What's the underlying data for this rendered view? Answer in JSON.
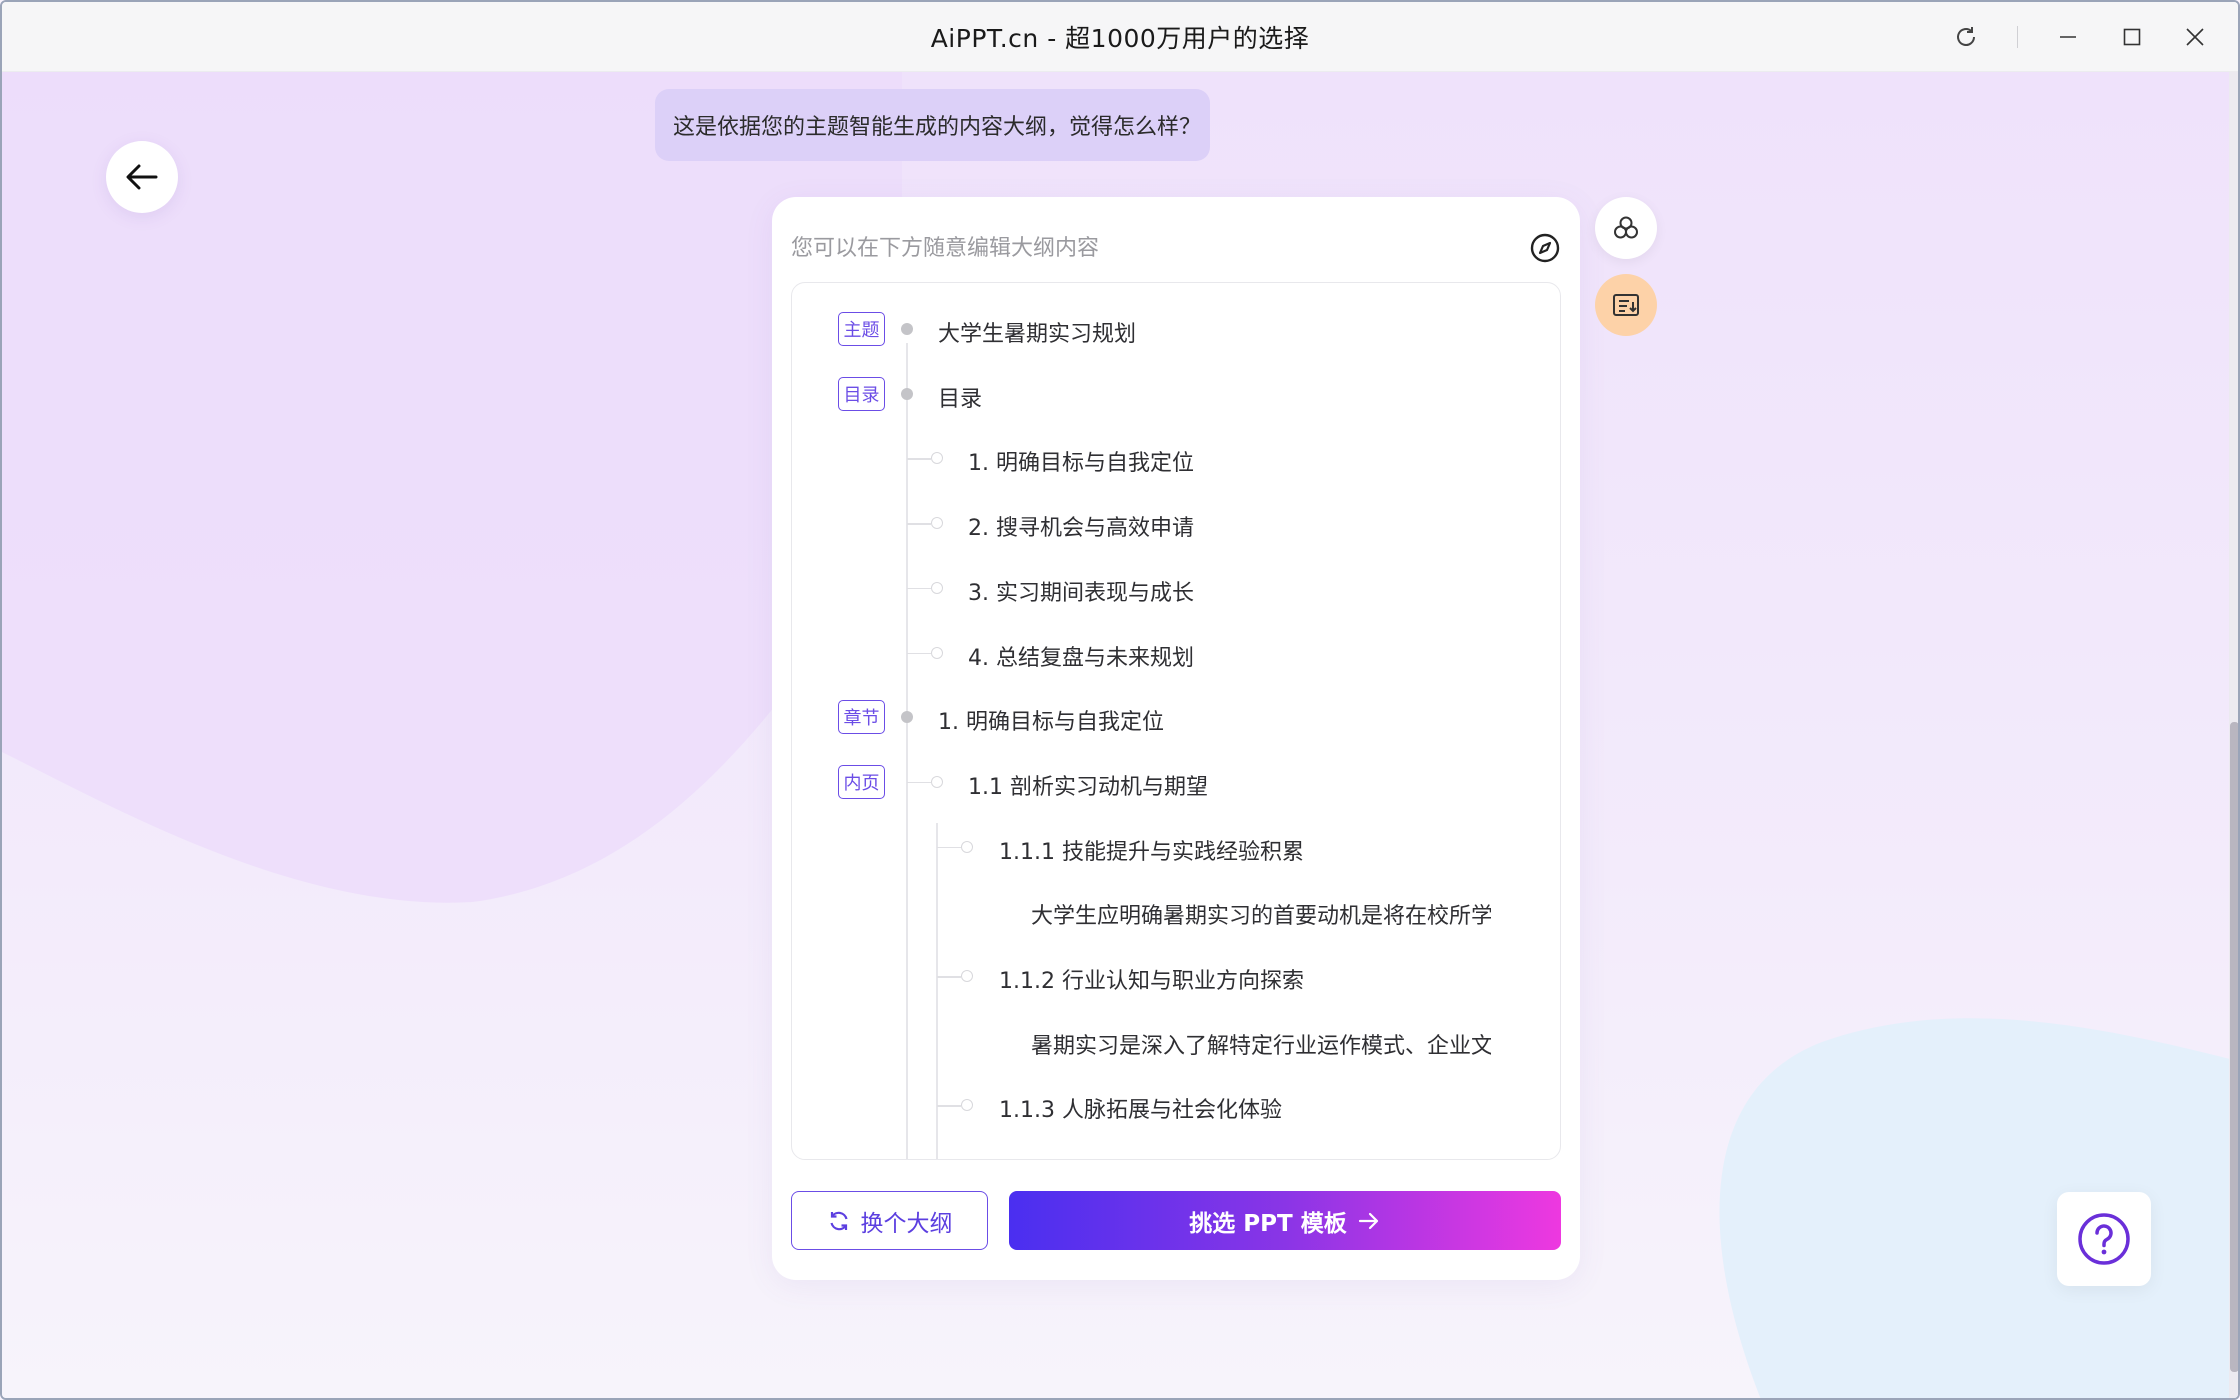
{
  "window": {
    "title": "AiPPT.cn - 超1000万用户的选择",
    "controls": [
      "refresh-icon",
      "minimize-icon",
      "maximize-icon",
      "close-icon"
    ]
  },
  "chat": {
    "message": "这是依据您的主题智能生成的内容大纲，觉得怎么样？"
  },
  "card": {
    "hint": "您可以在下方随意编辑大纲内容",
    "outline": [
      {
        "tag": "主题",
        "text": "大学生暑期实习规划",
        "level": 0
      },
      {
        "tag": "目录",
        "text": "目录",
        "level": 0
      },
      {
        "tag": "",
        "text": "1. 明确目标与自我定位",
        "level": 1
      },
      {
        "tag": "",
        "text": "2. 搜寻机会与高效申请",
        "level": 1
      },
      {
        "tag": "",
        "text": "3. 实习期间表现与成长",
        "level": 1
      },
      {
        "tag": "",
        "text": "4. 总结复盘与未来规划",
        "level": 1
      },
      {
        "tag": "章节",
        "text": "1. 明确目标与自我定位",
        "level": 0
      },
      {
        "tag": "内页",
        "text": "1.1 剖析实习动机与期望",
        "level": 1
      },
      {
        "tag": "",
        "text": "1.1.1 技能提升与实践经验积累",
        "level": 2
      },
      {
        "tag": "",
        "text": "大学生应明确暑期实习的首要动机是将在校所学",
        "level": 3
      },
      {
        "tag": "",
        "text": "1.1.2 行业认知与职业方向探索",
        "level": 2
      },
      {
        "tag": "",
        "text": "暑期实习是深入了解特定行业运作模式、企业文化",
        "level": 3
      },
      {
        "tag": "",
        "text": "1.1.3 人脉拓展与社会化体验",
        "level": 2
      }
    ],
    "change_button": "换个大纲",
    "pick_button": "挑选 PPT 模板"
  },
  "side_tools": [
    "templates-icon",
    "export-outline-icon"
  ],
  "help_icon": "question-icon",
  "colors": {
    "accent": "#6b4de6",
    "gradient_start": "#4a2ff0",
    "gradient_end": "#ee38e0",
    "bubble": "#dcd0f8"
  }
}
